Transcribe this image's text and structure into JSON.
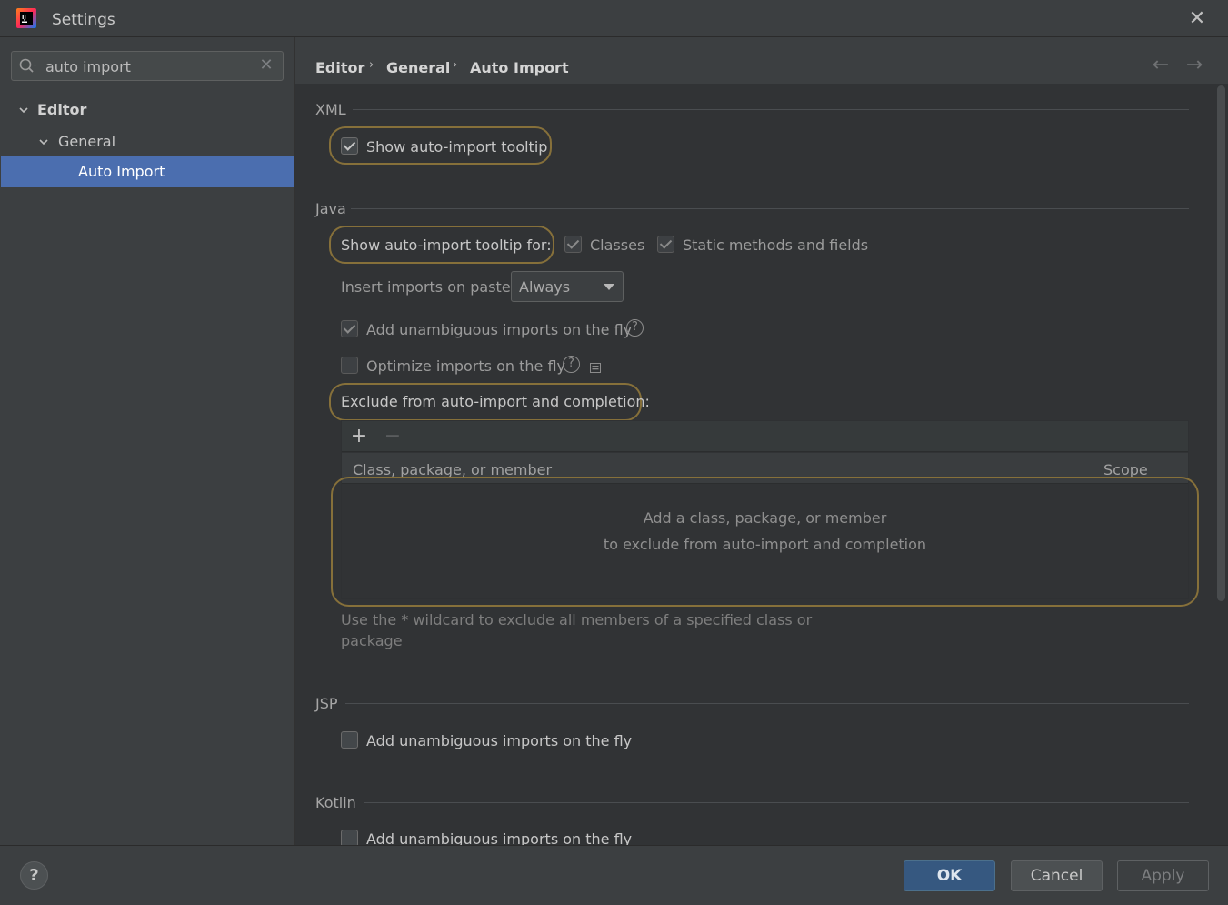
{
  "window": {
    "title": "Settings",
    "close_icon": "close-icon",
    "logo_icon": "intellij-logo-icon"
  },
  "search": {
    "value": "auto import",
    "icon": "search-icon",
    "clear_icon": "clear-icon"
  },
  "tree": {
    "items": [
      {
        "label": "Editor",
        "expanded": true
      },
      {
        "label": "General",
        "expanded": true
      },
      {
        "label": "Auto Import",
        "selected": true
      }
    ]
  },
  "breadcrumb": {
    "items": [
      "Editor",
      "General",
      "Auto Import"
    ],
    "separator": "›",
    "back_icon": "arrow-left-icon",
    "forward_icon": "arrow-right-icon"
  },
  "xml": {
    "section": "XML",
    "show_tooltip": {
      "label": "Show auto-import tooltip",
      "checked": true
    }
  },
  "java": {
    "section": "Java",
    "show_tooltip_for": "Show auto-import tooltip for:",
    "classes": {
      "label": "Classes",
      "checked": true
    },
    "static_methods": {
      "label": "Static methods and fields",
      "checked": true
    },
    "insert_imports_label": "Insert imports on paste:",
    "insert_imports_value": "Always",
    "add_unambiguous": {
      "label": "Add unambiguous imports on the fly",
      "checked": true
    },
    "optimize_imports": {
      "label": "Optimize imports on the fly",
      "checked": false
    },
    "exclude_label": "Exclude from auto-import and completion:",
    "table": {
      "add_label": "+",
      "remove_label": "−",
      "columns": [
        "Class, package, or member",
        "Scope"
      ],
      "empty_line1": "Add a class, package, or member",
      "empty_line2": "to exclude from auto-import and completion"
    },
    "note_line1": "Use the * wildcard to exclude all members of a specified class or",
    "note_line2": "package"
  },
  "jsp": {
    "section": "JSP",
    "add_unambiguous": {
      "label": "Add unambiguous imports on the fly",
      "checked": false
    }
  },
  "kotlin": {
    "section": "Kotlin",
    "add_unambiguous": {
      "label": "Add unambiguous imports on the fly",
      "checked": false
    }
  },
  "footer": {
    "help_label": "?",
    "ok_label": "OK",
    "cancel_label": "Cancel",
    "apply_label": "Apply"
  },
  "colors": {
    "selection": "#4b6eaf",
    "highlight_outline": "#86703a",
    "ok_button": "#365880"
  }
}
